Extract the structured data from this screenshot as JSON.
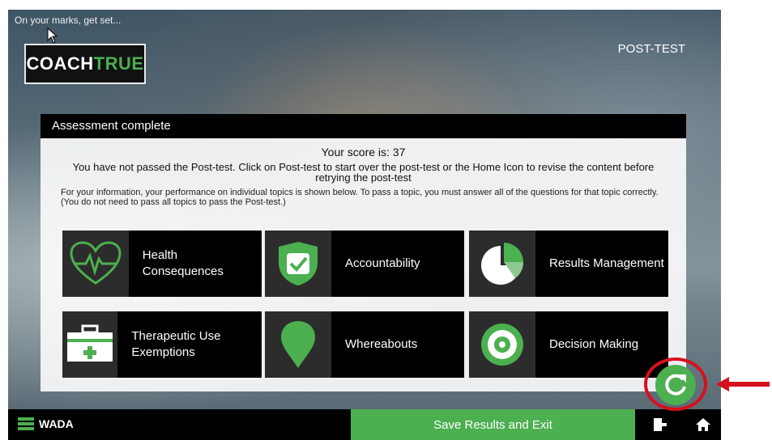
{
  "header": {
    "tagline": "On your marks, get set...",
    "logo_white": "COACH",
    "logo_green": "TRUE",
    "section": "POST-TEST"
  },
  "panel": {
    "title": "Assessment complete",
    "score_text": "Your score is: 37",
    "message": "You have not passed the Post-test. Click on Post-test to start over the post-test or the Home Icon to revise the content before retrying the post-test",
    "info": "For your information, your performance on individual topics is shown below. To pass a topic, you must answer all of the questions for that topic correctly. (You do not need to pass all topics to pass the Post-test.)"
  },
  "topics": [
    {
      "label": "Health Consequences",
      "icon": "heartbeat-icon"
    },
    {
      "label": "Accountability",
      "icon": "shield-check-icon"
    },
    {
      "label": "Results Management",
      "icon": "pie-chart-icon"
    },
    {
      "label": "Therapeutic Use Exemptions",
      "icon": "medical-kit-icon"
    },
    {
      "label": "Whereabouts",
      "icon": "map-pin-icon"
    },
    {
      "label": "Decision Making",
      "icon": "target-icon"
    }
  ],
  "footer": {
    "brand": "WADA",
    "save_label": "Save Results and Exit"
  },
  "colors": {
    "accent": "#4caf50",
    "highlight": "#d6101c",
    "bar": "#000000"
  }
}
